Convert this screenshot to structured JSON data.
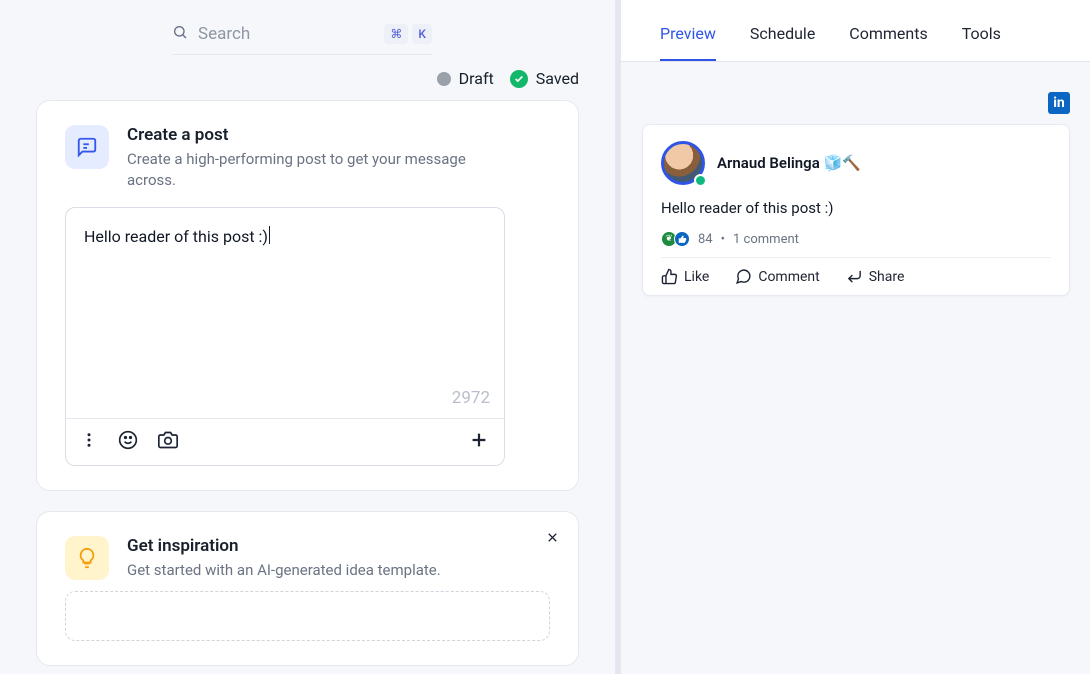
{
  "search": {
    "placeholder": "Search",
    "shortcutKeys": [
      "⌘",
      "K"
    ]
  },
  "status": {
    "draft": "Draft",
    "saved": "Saved"
  },
  "compose": {
    "title": "Create a post",
    "subtitle": "Create a high-performing post to get your message across.",
    "content": "Hello reader of this post :)",
    "charCount": "2972"
  },
  "inspiration": {
    "title": "Get inspiration",
    "subtitle": "Get started with an AI-generated idea template."
  },
  "tabs": [
    "Preview",
    "Schedule",
    "Comments",
    "Tools"
  ],
  "activeTab": "Preview",
  "preview": {
    "network": "LinkedIn",
    "author": "Arnaud Belinga 🧊🔨",
    "body": "Hello reader of this post :)",
    "stats": {
      "reactions": "84",
      "commentsText": "1 comment"
    },
    "actions": {
      "like": "Like",
      "comment": "Comment",
      "share": "Share"
    }
  }
}
